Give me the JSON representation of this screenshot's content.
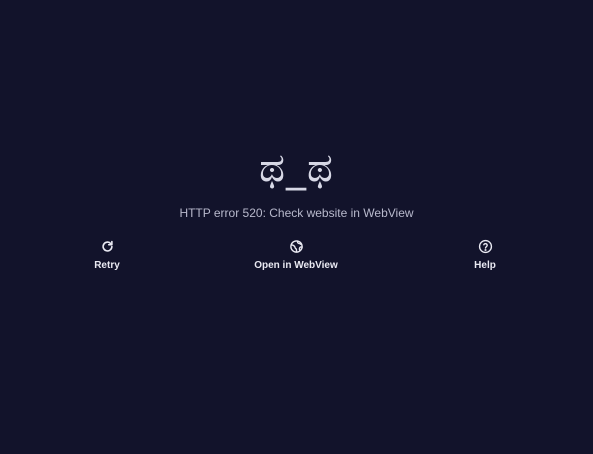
{
  "error": {
    "emoticon": "ಥ_ಥ",
    "message": "HTTP error 520: Check website in WebView"
  },
  "actions": [
    {
      "label": "Retry",
      "icon": "refresh-icon"
    },
    {
      "label": "Open in WebView",
      "icon": "globe-icon"
    },
    {
      "label": "Help",
      "icon": "help-circle-icon"
    }
  ],
  "colors": {
    "background": "#12132b",
    "text": "#e9e9f2",
    "secondary_text": "#b8b9cc"
  }
}
